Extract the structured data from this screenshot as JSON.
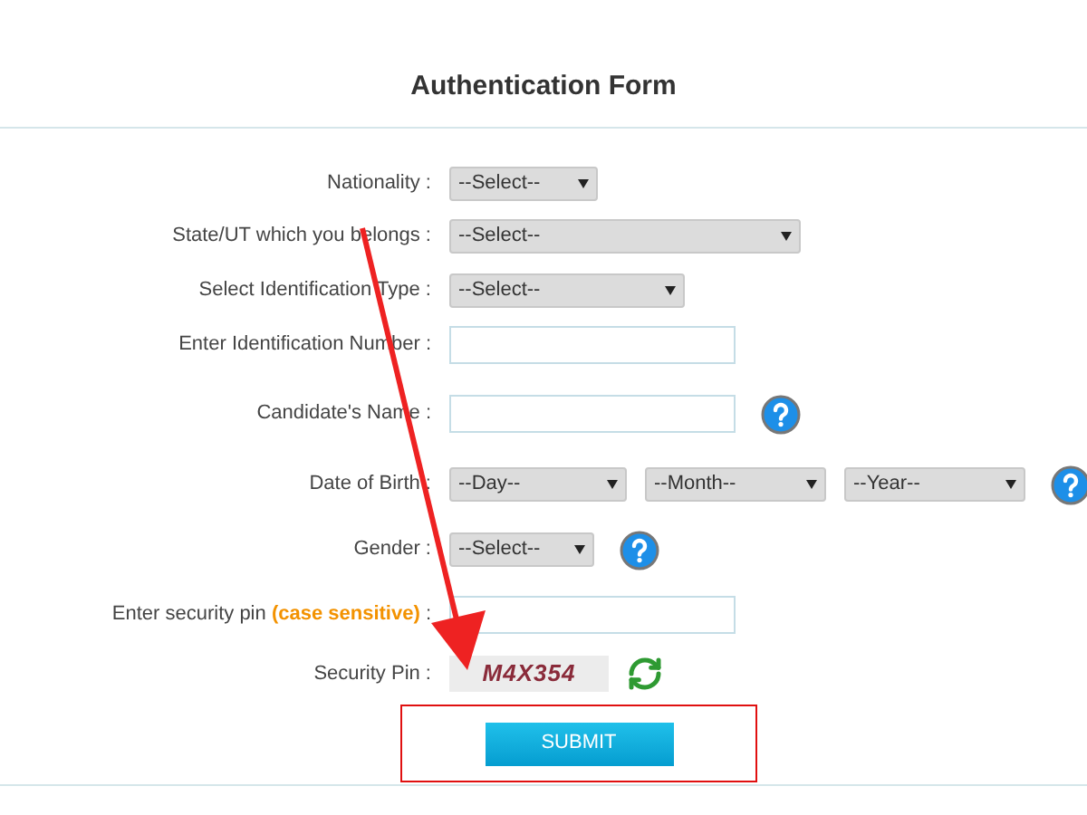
{
  "title": "Authentication Form",
  "rows": [
    {
      "kind": "select",
      "label": "Nationality :",
      "options": [
        "--Select--"
      ],
      "help": false
    },
    {
      "kind": "select",
      "label": "State/UT which you belongs :",
      "options": [
        "--Select--"
      ],
      "help": false
    },
    {
      "kind": "select",
      "label": "Select Identification Type :",
      "options": [
        "--Select--"
      ],
      "help": false
    },
    {
      "kind": "text",
      "label": "Enter Identification Number :",
      "help": false
    },
    {
      "kind": "text",
      "label": "Candidate's Name :",
      "help": true
    },
    {
      "kind": "select",
      "label": "Date of Birth :",
      "options": [
        "--Day--",
        "--Month--",
        "--Year--"
      ],
      "help": true
    },
    {
      "kind": "select",
      "label": "Gender :",
      "options": [
        "--Select--"
      ],
      "help": true
    },
    {
      "kind": "text",
      "label": "Enter security pin",
      "note": "(case sensitive)",
      "suffix": ":",
      "help": false
    },
    {
      "kind": "captcha",
      "label": "Security Pin :",
      "code": "M4X354",
      "help": false
    }
  ],
  "submit": "SUBMIT"
}
